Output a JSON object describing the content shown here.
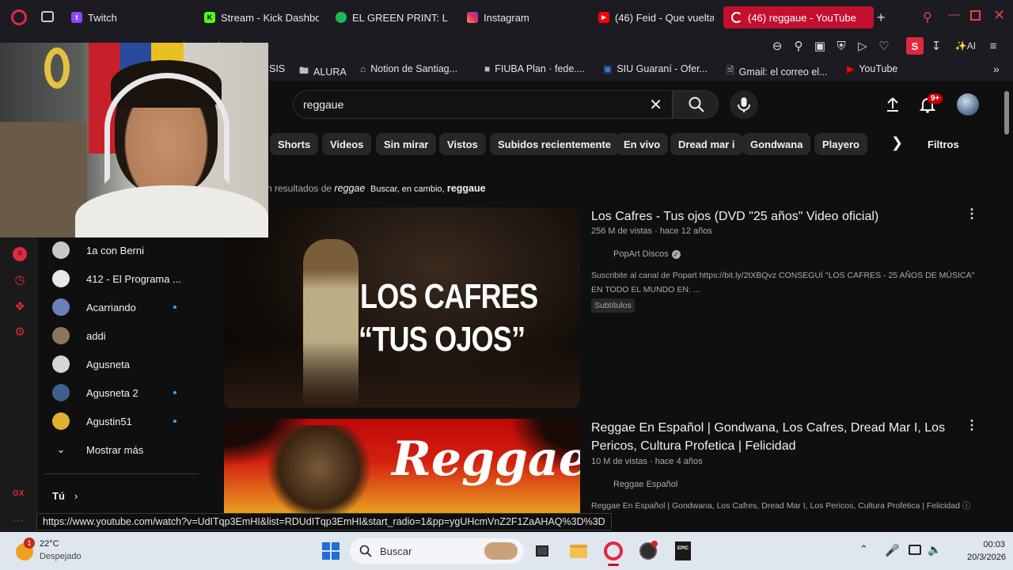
{
  "tabs": [
    {
      "label": "Twitch",
      "icon": "twitch-icon",
      "color": "#9146ff"
    },
    {
      "label": "Stream - Kick Dashbo",
      "icon": "kick-icon",
      "color": "#53fc18"
    },
    {
      "label": "EL GREEN PRINT: La",
      "icon": "spotify-icon",
      "color": "#1db954"
    },
    {
      "label": "Instagram",
      "icon": "instagram-icon",
      "color": "#e1306c"
    },
    {
      "label": "(46) Feid - Que vuelta",
      "icon": "youtube-icon",
      "color": "#ff0000"
    },
    {
      "label": "(46) reggaue - YouTube",
      "icon": "loading-icon",
      "color": "#ffffff"
    }
  ],
  "address": {
    "url": "www.youtube.com/results"
  },
  "bookmarks": [
    "SIS",
    "ALURA",
    "Notion de Santiag...",
    "FIUBA Plan · fede....",
    "SIU Guaraní - Ofer...",
    "Gmail: el correo el...",
    "YouTube"
  ],
  "search": {
    "query": "reggaue"
  },
  "notifications": {
    "count": "9+"
  },
  "chips": [
    "Shorts",
    "Videos",
    "Sin mirar",
    "Vistos",
    "Subidos recientemente",
    "En vivo",
    "Dread mar i",
    "Gondwana",
    "Playero"
  ],
  "filters_label": "Filtros",
  "correction": {
    "prefix": "n resultados de",
    "shown": "reggae",
    "alt_prefix": "Buscar, en cambio,",
    "alt": "reggaue"
  },
  "sidebar": {
    "subs": [
      {
        "name": "1a con Berni",
        "new": false,
        "color": "#c8c8c8"
      },
      {
        "name": "412 - El Programa ...",
        "new": false,
        "color": "#e8e8e8"
      },
      {
        "name": "Acarriando",
        "new": true,
        "color": "#6a7fb5"
      },
      {
        "name": "addi",
        "new": false,
        "color": "#8a7560"
      },
      {
        "name": "Agusneta",
        "new": false,
        "color": "#d6d6d6"
      },
      {
        "name": "Agusneta 2",
        "new": true,
        "color": "#3f5f8f"
      },
      {
        "name": "Agustin51",
        "new": true,
        "color": "#e0b030"
      }
    ],
    "show_more": "Mostrar más",
    "you": "Tú"
  },
  "results": [
    {
      "title": "Los Cafres - Tus ojos (DVD \"25 años\" Video oficial)",
      "views": "256 M de vistas · hace 12 años",
      "channel": "PopArt Discos",
      "desc": "Suscribite al canal de Popart https://bit.ly/2tXBQvz CONSEGUÍ \"LOS CAFRES - 25 AÑOS DE MÚSICA\" EN TODO EL MUNDO EN: ...",
      "badge": "Subtítulos",
      "thumb_line1": "LOS CAFRES",
      "thumb_line2": "“TUS OJOS”"
    },
    {
      "title": "Reggae En Español | Gondwana, Los Cafres, Dread Mar I, Los Pericos, Cultura Profetica | Felicidad",
      "views": "10 M de vistas · hace 4 años",
      "channel": "Reggae Español",
      "desc": "Reggae En Español | Gondwana, Los Cafres, Dread Mar I, Los Pericos, Cultura Profetica | Felicidad",
      "thumb_word": "Reggae"
    }
  ],
  "status_url": "https://www.youtube.com/watch?v=UdITqp3EmHI&list=RDUdITqp3EmHI&start_radio=1&pp=ygUHcmVnZ2F1ZaAHAQ%3D%3D",
  "taskbar": {
    "weather_temp": "22°C",
    "weather_desc": "Despejado",
    "weather_badge": "1",
    "search": "Buscar",
    "time": "00:03",
    "date": "20/3/2026"
  },
  "colors": {
    "accent": "#c3102f",
    "yt_red": "#ff0000",
    "link": "#3ea6ff"
  }
}
